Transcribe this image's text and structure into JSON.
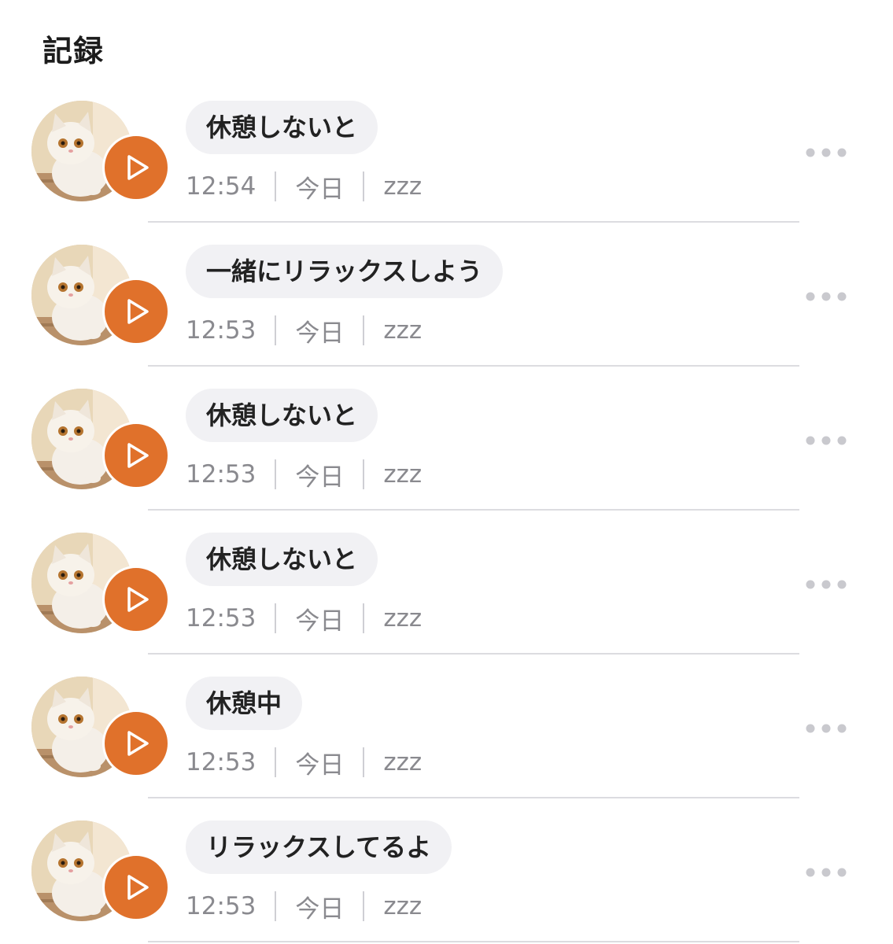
{
  "header": {
    "title": "記録"
  },
  "records": [
    {
      "text": "休憩しないと",
      "time": "12:54",
      "day": "今日",
      "tag": "zzz"
    },
    {
      "text": "一緒にリラックスしよう",
      "time": "12:53",
      "day": "今日",
      "tag": "zzz"
    },
    {
      "text": "休憩しないと",
      "time": "12:53",
      "day": "今日",
      "tag": "zzz"
    },
    {
      "text": "休憩しないと",
      "time": "12:53",
      "day": "今日",
      "tag": "zzz"
    },
    {
      "text": "休憩中",
      "time": "12:53",
      "day": "今日",
      "tag": "zzz"
    },
    {
      "text": "リラックスしてるよ",
      "time": "12:53",
      "day": "今日",
      "tag": "zzz"
    }
  ],
  "icons": {
    "play": "play-icon",
    "more": "more-dots-icon",
    "avatar": "cat-avatar"
  },
  "colors": {
    "accent": "#e0712b",
    "bubble": "#f1f1f4",
    "meta_text": "#8a8a8f",
    "divider": "#dcdce0"
  }
}
